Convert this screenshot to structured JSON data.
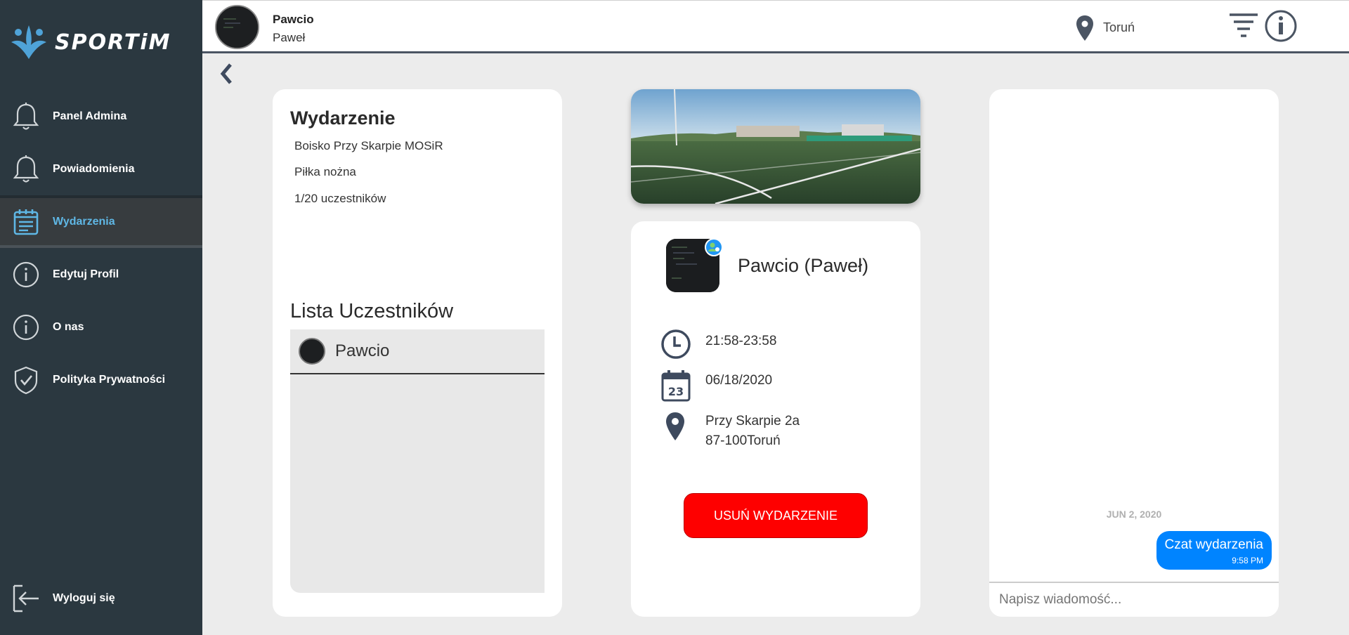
{
  "app": {
    "logo_text": "SPORTiM"
  },
  "sidebar": {
    "items": [
      {
        "label": "Panel Admina",
        "icon": "bell-icon"
      },
      {
        "label": "Powiadomienia",
        "icon": "bell-icon"
      },
      {
        "label": "Wydarzenia",
        "icon": "calendar-list-icon",
        "active": true
      },
      {
        "label": "Edytuj Profil",
        "icon": "info-circle-icon"
      },
      {
        "label": "O nas",
        "icon": "info-circle-icon"
      },
      {
        "label": "Polityka Prywatności",
        "icon": "shield-check-icon"
      }
    ],
    "logout": {
      "label": "Wyloguj się",
      "icon": "logout-icon"
    }
  },
  "header": {
    "user_nick": "Pawcio",
    "user_name": "Paweł",
    "location": "Toruń"
  },
  "event": {
    "title": "Wydarzenie",
    "venue": "Boisko Przy Skarpie MOSiR",
    "sport": "Piłka nożna",
    "participants_count": "1/20 uczestników",
    "participants_title": "Lista Uczestników",
    "participants": [
      {
        "name": "Pawcio"
      }
    ]
  },
  "details": {
    "organizer": "Pawcio (Paweł)",
    "time": "21:58-23:58",
    "date": "06/18/2020",
    "calendar_day": "23",
    "address_line1": "Przy Skarpie 2a",
    "address_line2": "87-100Toruń",
    "delete_label": "USUŃ WYDARZENIE"
  },
  "chat": {
    "date_separator": "JUN 2, 2020",
    "messages": [
      {
        "text": "Czat wydarzenia",
        "time": "9:58 PM"
      }
    ],
    "input_placeholder": "Napisz wiadomość..."
  },
  "colors": {
    "sidebar_bg": "#2b3840",
    "active_accent": "#5fb7e5",
    "delete_button": "#fe0000",
    "chat_bubble": "#0084ff"
  }
}
